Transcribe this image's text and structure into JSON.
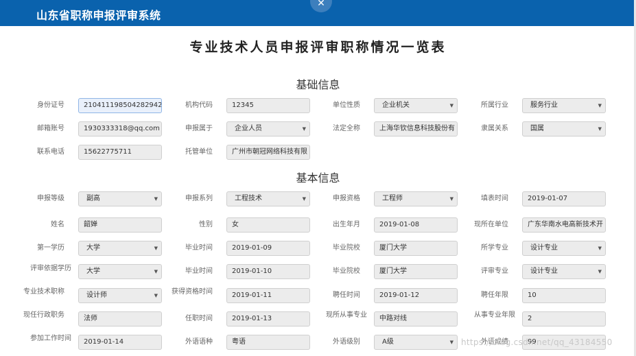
{
  "header": {
    "title": "山东省职称申报评审系统",
    "close_glyph": "✕"
  },
  "page_title": "专业技术人员申报评审职称情况一览表",
  "section1": {
    "title": "基础信息"
  },
  "section2": {
    "title": "基本信息"
  },
  "fields": {
    "id_no": {
      "label": "身份证号",
      "value": "210411198504282942"
    },
    "org_code": {
      "label": "机构代码",
      "value": "12345"
    },
    "unit_nature": {
      "label": "单位性质",
      "value": "企业机关"
    },
    "industry": {
      "label": "所属行业",
      "value": "服务行业"
    },
    "email": {
      "label": "邮箱账号",
      "value": "1930333318@qq.com"
    },
    "apply_belong": {
      "label": "申报属于",
      "value": "企业人员"
    },
    "legal_name": {
      "label": "法定全称",
      "value": "上海华钦信息科技股份有"
    },
    "affiliation": {
      "label": "隶属关系",
      "value": "国属"
    },
    "phone": {
      "label": "联系电话",
      "value": "15622775711"
    },
    "custody_unit": {
      "label": "托管单位",
      "value": "广州市朝冠网络科技有限"
    },
    "apply_level": {
      "label": "申报等级",
      "value": "副高"
    },
    "apply_series": {
      "label": "申报系列",
      "value": "工程技术"
    },
    "apply_qual": {
      "label": "申报资格",
      "value": "工程师"
    },
    "fill_time": {
      "label": "填表时间",
      "value": "2019-01-07"
    },
    "name": {
      "label": "姓名",
      "value": "韶婵"
    },
    "gender": {
      "label": "性别",
      "value": "女"
    },
    "birth": {
      "label": "出生年月",
      "value": "2019-01-08"
    },
    "current_unit": {
      "label": "现所在单位",
      "value": "广东华南水电高新技术开"
    },
    "first_edu": {
      "label": "第一学历",
      "value": "大学"
    },
    "grad_time1": {
      "label": "毕业时间",
      "value": "2019-01-09"
    },
    "school1": {
      "label": "毕业院校",
      "value": "厦门大学"
    },
    "major1": {
      "label": "所学专业",
      "value": "设计专业"
    },
    "review_edu": {
      "label": "评审依据学历",
      "value": "大学"
    },
    "grad_time2": {
      "label": "毕业时间",
      "value": "2019-01-10"
    },
    "school2": {
      "label": "毕业院校",
      "value": "厦门大学"
    },
    "review_major": {
      "label": "评审专业",
      "value": "设计专业"
    },
    "tech_title": {
      "label": "专业技术职称",
      "value": "设计师"
    },
    "qual_time": {
      "label": "获得资格时间",
      "value": "2019-01-11"
    },
    "hire_time": {
      "label": "聘任时间",
      "value": "2019-01-12"
    },
    "hire_years": {
      "label": "聘任年限",
      "value": "10"
    },
    "admin_post": {
      "label": "现任行政职务",
      "value": "法师"
    },
    "post_time": {
      "label": "任职时间",
      "value": "2019-01-13"
    },
    "current_major": {
      "label": "现所从事专业",
      "value": "中路对线"
    },
    "major_years": {
      "label": "从事专业年限",
      "value": "2"
    },
    "work_start": {
      "label": "参加工作时间",
      "value": "2019-01-14"
    },
    "language": {
      "label": "外语语种",
      "value": "粤语"
    },
    "lang_level": {
      "label": "外语级别",
      "value": "A级"
    },
    "lang_score": {
      "label": "外语成绩",
      "value": "99"
    }
  },
  "watermark": "https://blog.csdn.net/qq_43184550"
}
